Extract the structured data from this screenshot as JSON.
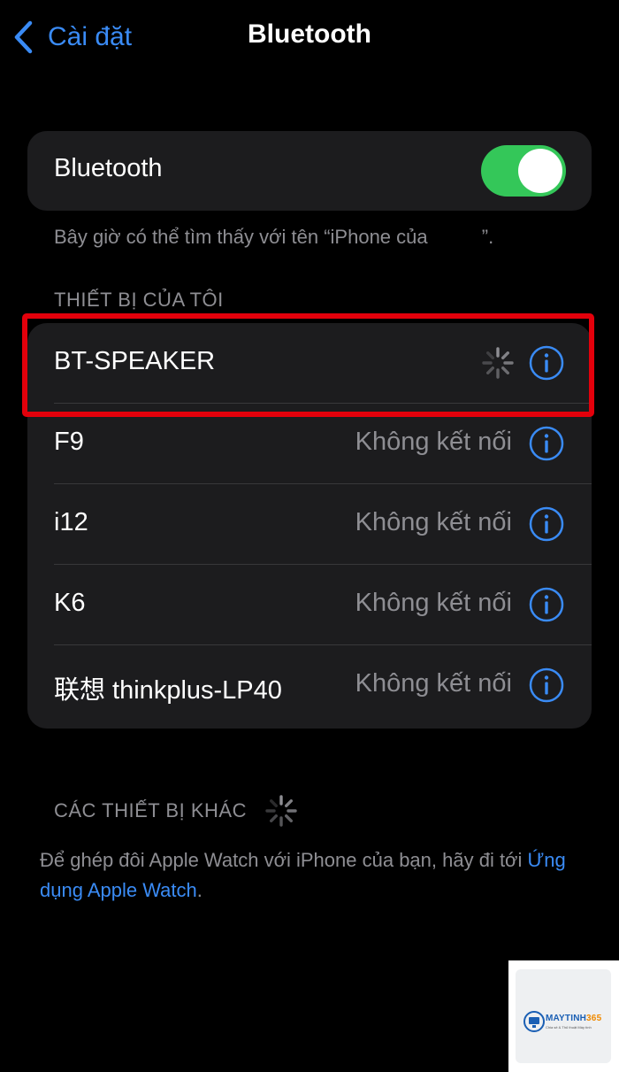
{
  "nav": {
    "back_label": "Cài đặt",
    "title": "Bluetooth"
  },
  "bluetooth": {
    "label": "Bluetooth",
    "enabled": true,
    "discoverable_note": "Bây giờ có thể tìm thấy với tên “iPhone của          ”."
  },
  "my_devices": {
    "header": "THIẾT BỊ CỦA TÔI",
    "items": [
      {
        "name": "BT-SPEAKER",
        "status": "",
        "connecting": true
      },
      {
        "name": "F9",
        "status": "Không kết nối",
        "connecting": false
      },
      {
        "name": "i12",
        "status": "Không kết nối",
        "connecting": false
      },
      {
        "name": "K6",
        "status": "Không kết nối",
        "connecting": false
      },
      {
        "name": "联想 thinkplus-LP40",
        "status": "Không kết nối",
        "connecting": false
      }
    ]
  },
  "other_devices": {
    "header": "CÁC THIẾT BỊ KHÁC",
    "watch_note": "Để ghép đôi Apple Watch với iPhone của bạn, hãy đi tới ",
    "watch_link": "Ứng dụng Apple Watch",
    "watch_note_end": "."
  },
  "watermark": {
    "brand_a": "MAYTINH",
    "brand_b": "365",
    "tagline": "Chia sẻ & Thủ thuật Máy tính"
  },
  "colors": {
    "accent": "#3a8bf5",
    "toggle_on": "#34c759",
    "highlight": "#e3000b",
    "group_bg": "#1c1c1e",
    "secondary_text": "#8e8e93"
  }
}
